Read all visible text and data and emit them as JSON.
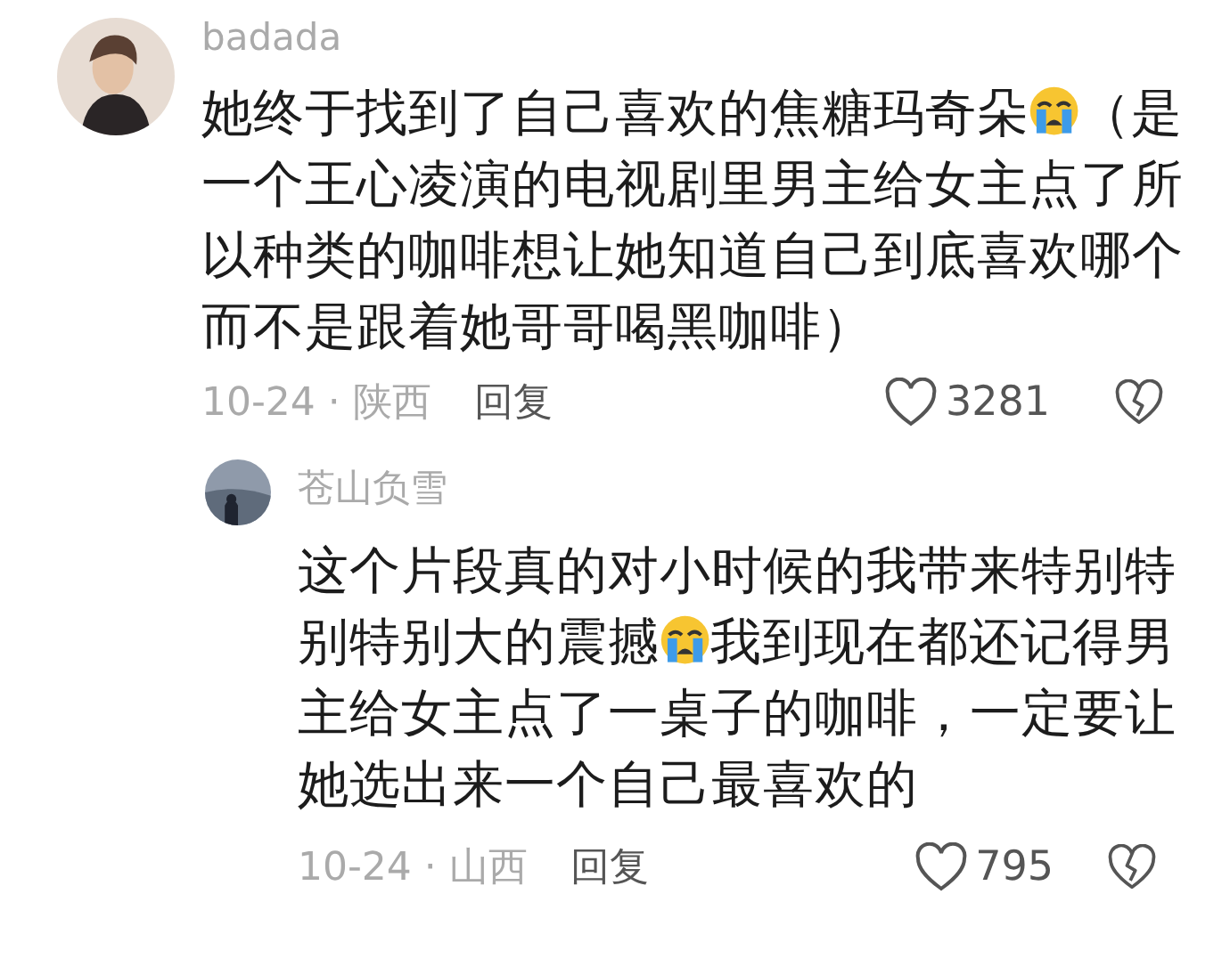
{
  "comments": [
    {
      "author": "badada",
      "parts": [
        {
          "kind": "text",
          "text": "她终于找到了自己喜欢的焦糖玛奇朵"
        },
        {
          "kind": "emoji"
        },
        {
          "kind": "text",
          "text": "（是一个王心凌演的电视剧里男主给女主点了所以种类的咖啡想让她知道自己到底喜欢哪个而不是跟着她哥哥喝黑咖啡）"
        }
      ],
      "date": "10-24",
      "separator": "·",
      "location": "陕西",
      "reply_label": "回复",
      "likes": "3281",
      "reply": false
    },
    {
      "author": "苍山负雪",
      "parts": [
        {
          "kind": "text",
          "text": "这个片段真的对小时候的我带来特别特别特别大的震撼"
        },
        {
          "kind": "emoji"
        },
        {
          "kind": "text",
          "text": "我到现在都还记得男主给女主点了一桌子的咖啡，一定要让她选出来一个自己最喜欢的"
        }
      ],
      "date": "10-24",
      "separator": "·",
      "location": "山西",
      "reply_label": "回复",
      "likes": "795",
      "reply": true
    }
  ]
}
